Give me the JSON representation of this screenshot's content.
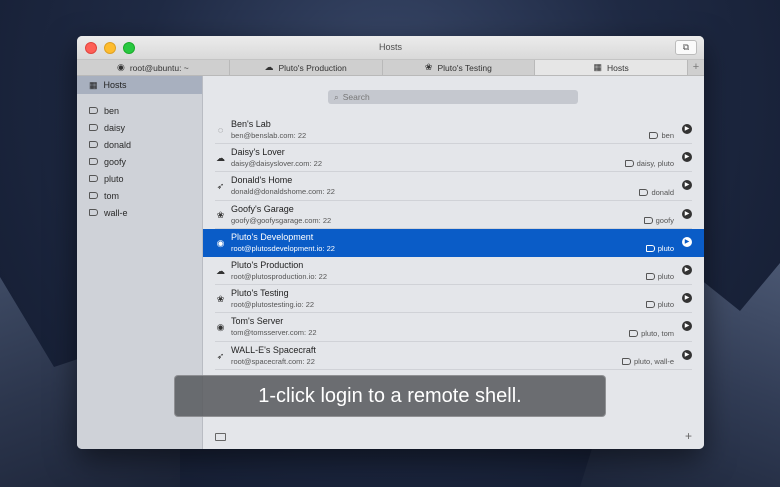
{
  "window": {
    "title": "Hosts",
    "fullscreen_glyph": "⧉"
  },
  "tabs": [
    {
      "label": "root@ubuntu: ~",
      "icon": "ubuntu-icon",
      "glyph": "◉"
    },
    {
      "label": "Pluto's Production",
      "icon": "cloud-icon",
      "glyph": "☁"
    },
    {
      "label": "Pluto's Testing",
      "icon": "raspberry-icon",
      "glyph": "❀"
    },
    {
      "label": "Hosts",
      "icon": "hosts-grid-icon",
      "glyph": "▦"
    }
  ],
  "tab_add_glyph": "+",
  "sidebar": {
    "selected": {
      "label": "Hosts",
      "glyph": "▦"
    },
    "tags": [
      "ben",
      "daisy",
      "donald",
      "goofy",
      "pluto",
      "tom",
      "wall-e"
    ]
  },
  "search": {
    "placeholder": "Search",
    "glyph": "⌕"
  },
  "hosts": [
    {
      "name": "Ben's Lab",
      "addr": "ben@benslab.com: 22",
      "tags": "ben",
      "glyph": "◌"
    },
    {
      "name": "Daisy's Lover",
      "addr": "daisy@daisyslover.com: 22",
      "tags": "daisy, pluto",
      "glyph": "☁"
    },
    {
      "name": "Donald's Home",
      "addr": "donald@donaldshome.com: 22",
      "tags": "donald",
      "glyph": "➶"
    },
    {
      "name": "Goofy's Garage",
      "addr": "goofy@goofysgarage.com: 22",
      "tags": "goofy",
      "glyph": "❀"
    },
    {
      "name": "Pluto's Development",
      "addr": "root@plutosdevelopment.io: 22",
      "tags": "pluto",
      "glyph": "◉"
    },
    {
      "name": "Pluto's Production",
      "addr": "root@plutosproduction.io: 22",
      "tags": "pluto",
      "glyph": "☁"
    },
    {
      "name": "Pluto's Testing",
      "addr": "root@plutostesting.io: 22",
      "tags": "pluto",
      "glyph": "❀"
    },
    {
      "name": "Tom's Server",
      "addr": "tom@tomsserver.com: 22",
      "tags": "pluto, tom",
      "glyph": "◉"
    },
    {
      "name": "WALL-E's Spacecraft",
      "addr": "root@spacecraft.com: 22",
      "tags": "pluto, wall-e",
      "glyph": "➶"
    }
  ],
  "selected_host_index": 4,
  "play_glyph": "▶",
  "add_glyph": "+",
  "overlay_text": "1-click login to a remote shell.",
  "colors": {
    "accent": "#0a5cc7"
  }
}
